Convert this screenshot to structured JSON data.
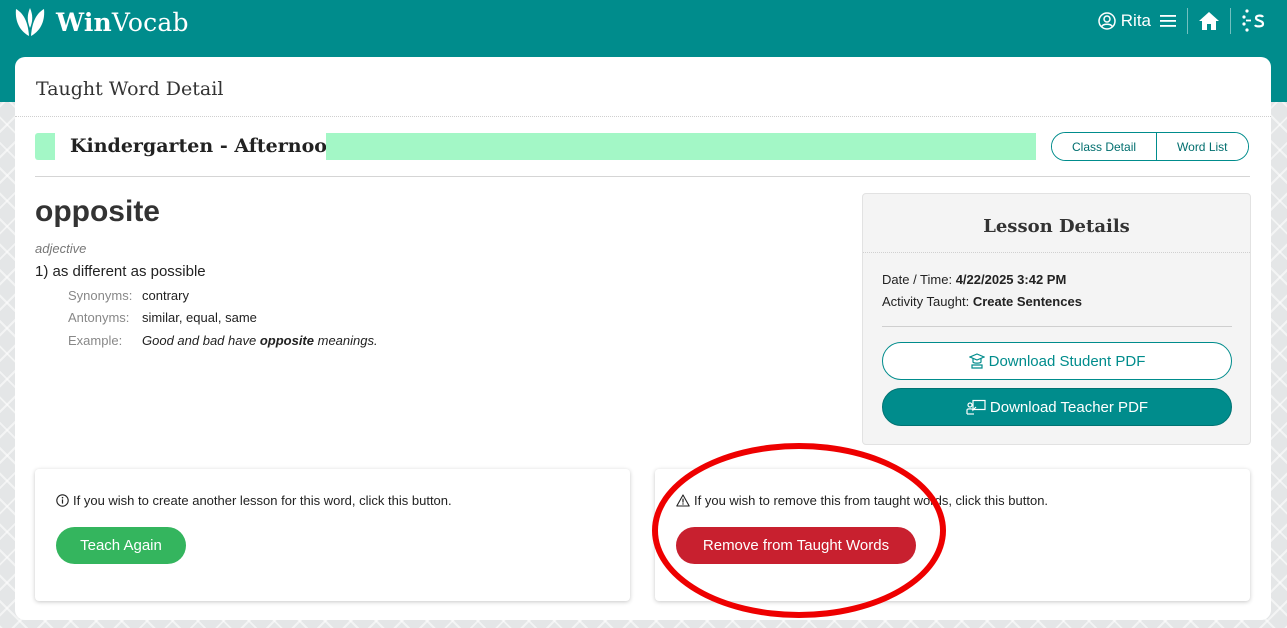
{
  "header": {
    "brand_bold": "Win",
    "brand_rest": "Vocab",
    "user_name": "Rita",
    "icons": [
      "leaf-logo-icon",
      "user-circle-icon",
      "menu-icon",
      "home-icon",
      "spark-s-icon"
    ]
  },
  "page": {
    "title": "Taught Word Detail",
    "class_name": "Kindergarten - Afternoon",
    "buttons": {
      "class_detail": "Class Detail",
      "word_list": "Word List"
    }
  },
  "word": {
    "term": "opposite",
    "part_of_speech": "adjective",
    "definition": "1) as different as possible",
    "synonyms_label": "Synonyms:",
    "synonyms": "contrary",
    "antonyms_label": "Antonyms:",
    "antonyms": "similar, equal, same",
    "example_label": "Example:",
    "example_before": "Good and bad have ",
    "example_bold": "opposite",
    "example_after": " meanings."
  },
  "lesson": {
    "title": "Lesson Details",
    "datetime_label": "Date / Time: ",
    "datetime": "4/22/2025 3:42 PM",
    "activity_label": "Activity Taught: ",
    "activity": "Create Sentences",
    "student_pdf": "Download Student PDF",
    "teacher_pdf": "Download Teacher PDF"
  },
  "actions": {
    "teach_msg": "If you wish to create another lesson for this word, click this button.",
    "teach_button": "Teach Again",
    "remove_msg": "If you wish to remove this from taught words, click this button.",
    "remove_button": "Remove from Taught Words"
  },
  "colors": {
    "brand_teal": "#008c8c",
    "class_bar": "#a3f7c6",
    "teach_green": "#34b55e",
    "remove_red": "#c8202f",
    "annotation_red": "#ee0000"
  }
}
